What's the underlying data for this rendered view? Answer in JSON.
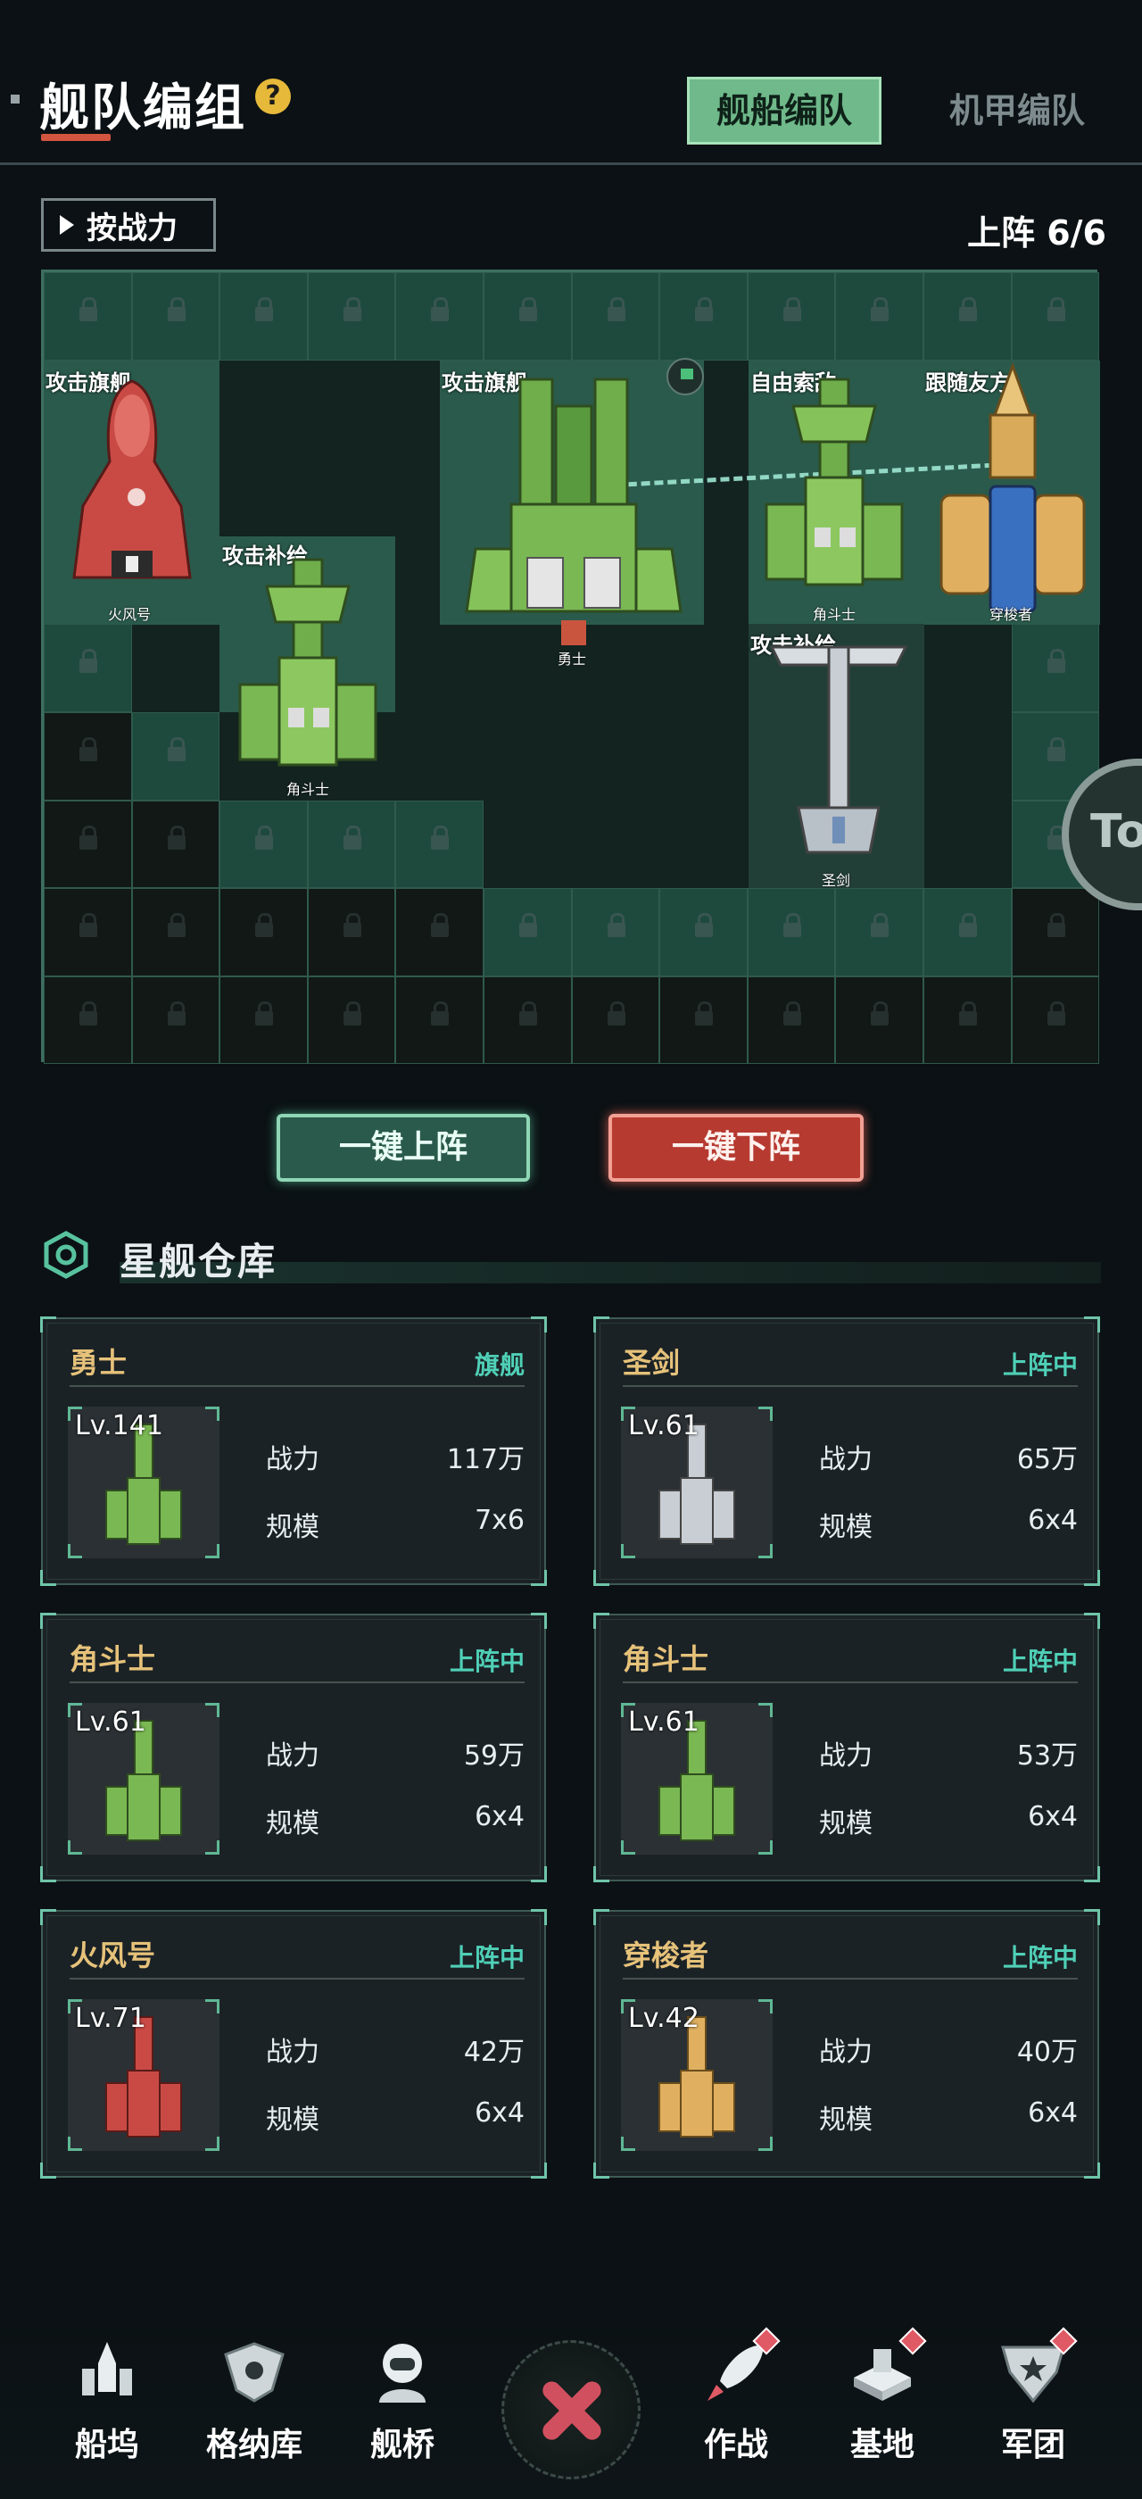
{
  "header": {
    "title": "舰队编组",
    "help_symbol": "?",
    "tabs": [
      {
        "label": "舰船编队",
        "active": true
      },
      {
        "label": "机甲编队",
        "active": false
      }
    ]
  },
  "toolbar": {
    "sort_label": "按战力",
    "deploy_count": "上阵 6/6"
  },
  "formation": {
    "slots": [
      {
        "role": "攻击旗舰",
        "ship": "火风号"
      },
      {
        "role": "攻击补给",
        "ship": "角斗士"
      },
      {
        "role": "攻击旗舰",
        "ship": "勇士"
      },
      {
        "role": "自由索敌",
        "ship": "角斗士"
      },
      {
        "role": "跟随友方",
        "ship": "穿梭者"
      },
      {
        "role": "攻击补给",
        "ship": "圣剑"
      }
    ],
    "side_badge": "To"
  },
  "actions": {
    "deploy_all": "一键上阵",
    "undeploy_all": "一键下阵"
  },
  "warehouse": {
    "title": "星舰仓库",
    "stat_labels": {
      "power": "战力",
      "scale": "规模"
    },
    "cards": [
      {
        "name": "勇士",
        "status": "旗舰",
        "level": "Lv.141",
        "power": "117万",
        "scale": "7x6",
        "icon": "warrior-ship-icon"
      },
      {
        "name": "圣剑",
        "status": "上阵中",
        "level": "Lv.61",
        "power": "65万",
        "scale": "6x4",
        "icon": "holy-sword-ship-icon"
      },
      {
        "name": "角斗士",
        "status": "上阵中",
        "level": "Lv.61",
        "power": "59万",
        "scale": "6x4",
        "icon": "gladiator-ship-icon"
      },
      {
        "name": "角斗士",
        "status": "上阵中",
        "level": "Lv.61",
        "power": "53万",
        "scale": "6x4",
        "icon": "gladiator-ship-icon"
      },
      {
        "name": "火风号",
        "status": "上阵中",
        "level": "Lv.71",
        "power": "42万",
        "scale": "6x4",
        "icon": "fire-wind-ship-icon"
      },
      {
        "name": "穿梭者",
        "status": "上阵中",
        "level": "Lv.42",
        "power": "40万",
        "scale": "6x4",
        "icon": "shuttle-ship-icon"
      }
    ]
  },
  "bottom_nav": [
    {
      "label": "船坞",
      "icon": "dock-icon",
      "badge": false
    },
    {
      "label": "格纳库",
      "icon": "hangar-icon",
      "badge": false
    },
    {
      "label": "舰桥",
      "icon": "bridge-icon",
      "badge": false
    },
    {
      "label": "",
      "icon": "battle-center-icon",
      "badge": false
    },
    {
      "label": "作战",
      "icon": "rocket-icon",
      "badge": true
    },
    {
      "label": "基地",
      "icon": "base-icon",
      "badge": true
    },
    {
      "label": "军团",
      "icon": "legion-icon",
      "badge": true
    }
  ],
  "colors": {
    "background": "#0b1114",
    "accent_green": "#6fb98a",
    "accent_red": "#b63a30",
    "status_teal": "#4fd0b7",
    "ship_name_gold": "#e6c27a"
  }
}
